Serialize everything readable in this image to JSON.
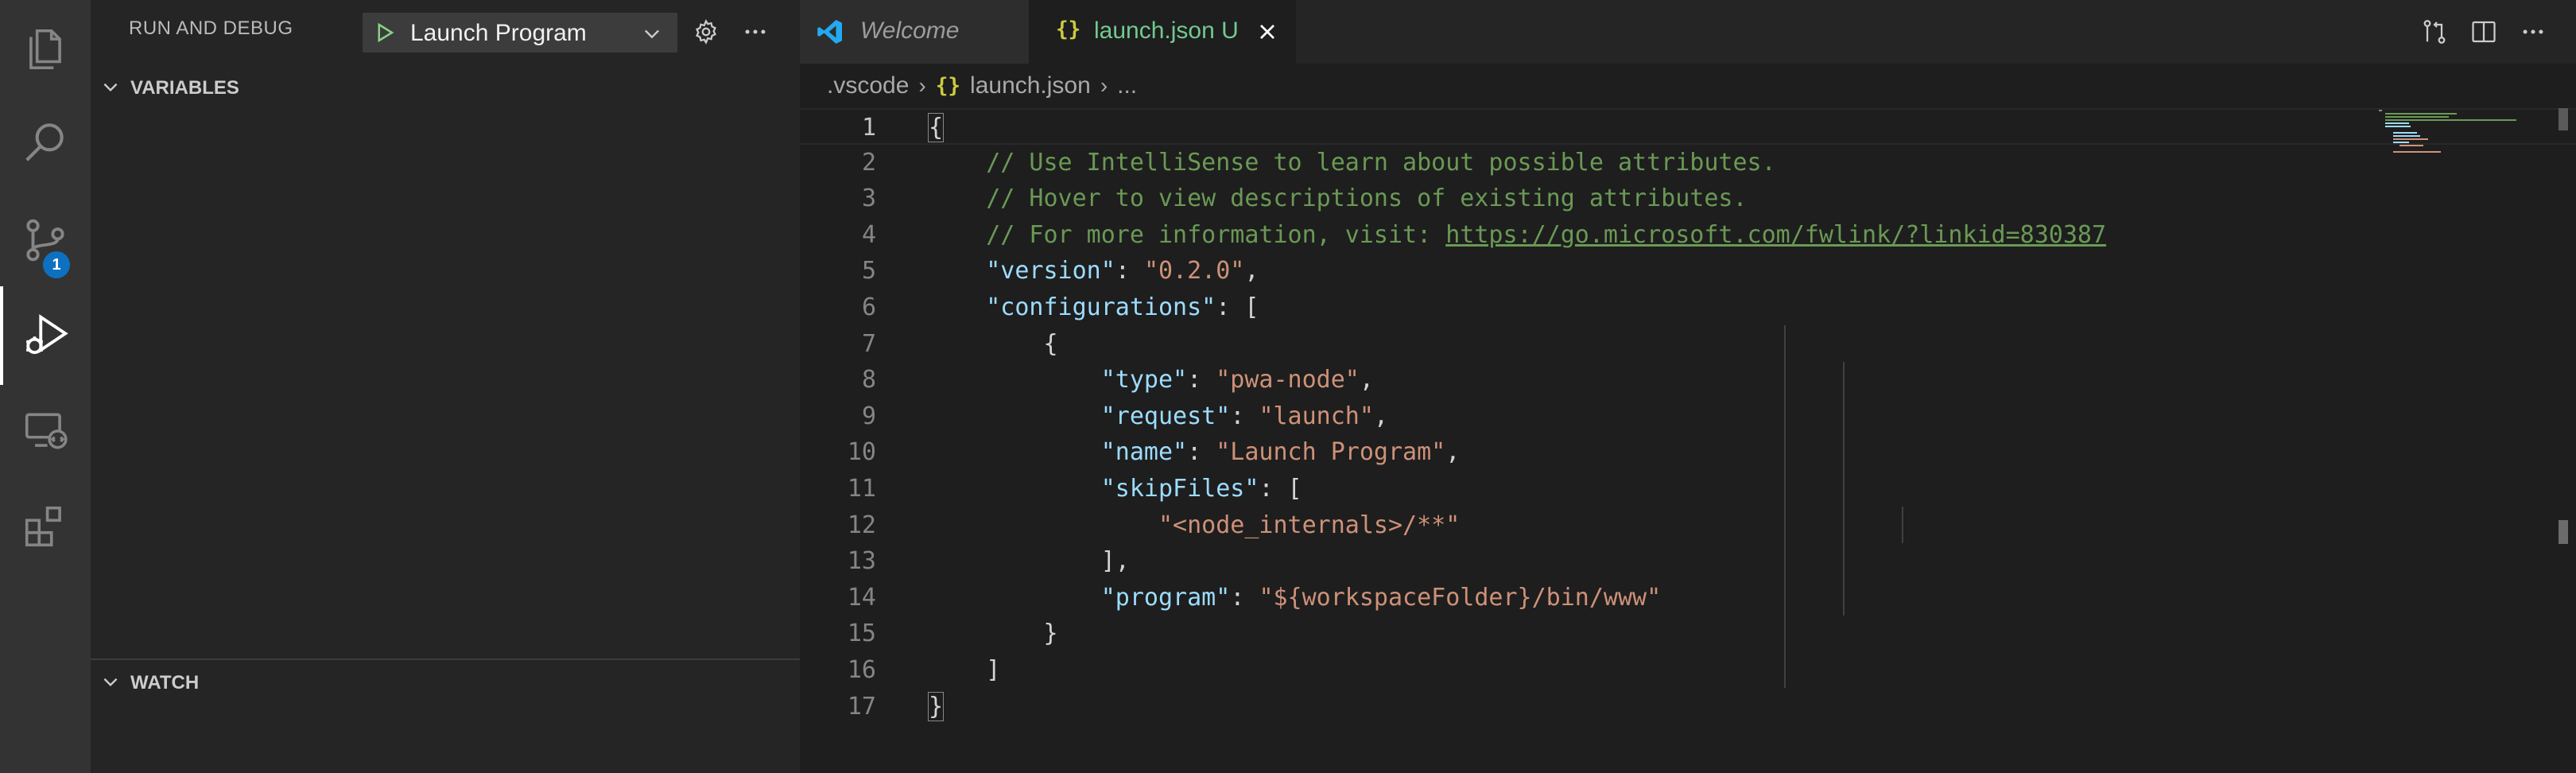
{
  "sidebar": {
    "title": "RUN AND DEBUG",
    "config_name": "Launch Program",
    "sections": {
      "variables": "VARIABLES",
      "watch": "WATCH"
    }
  },
  "activity_bar": {
    "items": [
      {
        "name": "explorer-icon"
      },
      {
        "name": "search-icon"
      },
      {
        "name": "source-control-icon",
        "badge": "1"
      },
      {
        "name": "run-debug-icon",
        "active": true
      },
      {
        "name": "remote-explorer-icon"
      },
      {
        "name": "extensions-icon"
      }
    ],
    "badge_color": "#0e70c0"
  },
  "tabs": [
    {
      "label": "Welcome",
      "active": false
    },
    {
      "label": "launch.json",
      "status": "U",
      "active": true
    }
  ],
  "breadcrumb": {
    "folder": ".vscode",
    "file": "launch.json",
    "more": "..."
  },
  "editor": {
    "active_line": 1,
    "lines": [
      "{",
      "    // Use IntelliSense to learn about possible attributes.",
      "    // Hover to view descriptions of existing attributes.",
      "    // For more information, visit: https://go.microsoft.com/fwlink/?linkid=830387",
      "    \"version\": \"0.2.0\",",
      "    \"configurations\": [",
      "        {",
      "            \"type\": \"pwa-node\",",
      "            \"request\": \"launch\",",
      "            \"name\": \"Launch Program\",",
      "            \"skipFiles\": [",
      "                \"<node_internals>/**\"",
      "            ],",
      "            \"program\": \"${workspaceFolder}/bin/www\"",
      "        }",
      "    ]",
      "}"
    ],
    "link": "https://go.microsoft.com/fwlink/?linkid=830387"
  },
  "colors": {
    "comment": "#6a9955",
    "key": "#9cdcfe",
    "string": "#ce9178",
    "untracked": "#73c991",
    "json_icon": "#cbcb41"
  }
}
